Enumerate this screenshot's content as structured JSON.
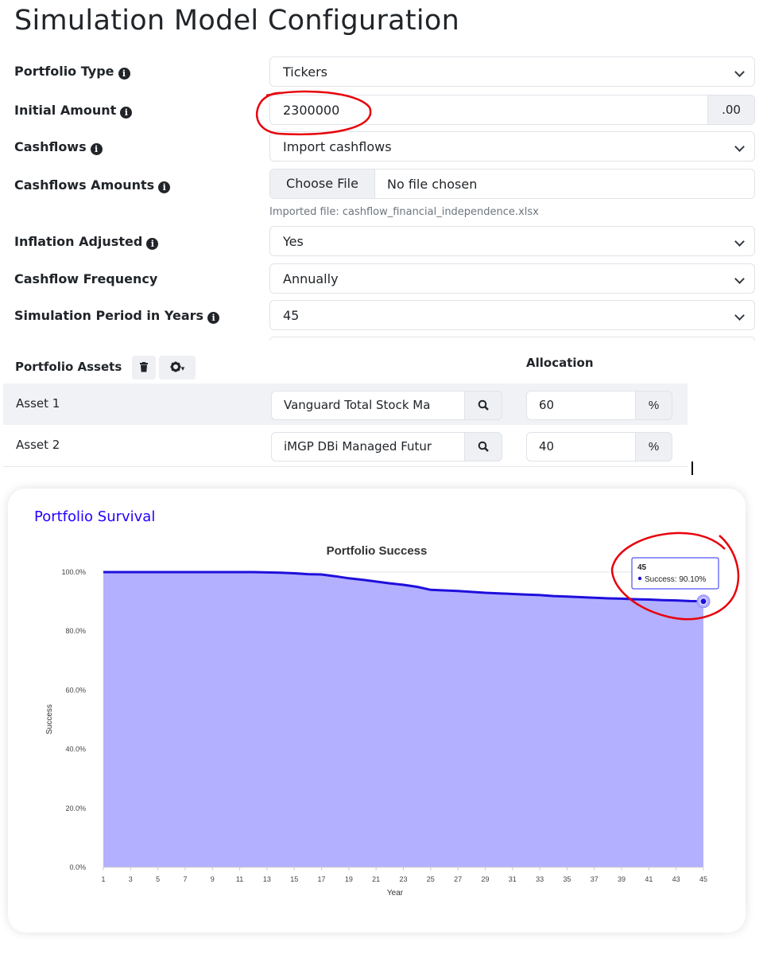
{
  "page_title": "Simulation Model Configuration",
  "form": {
    "portfolio_type": {
      "label": "Portfolio Type",
      "value": "Tickers"
    },
    "initial_amount": {
      "label": "Initial Amount",
      "value": "2300000",
      "addon": ".00"
    },
    "cashflows": {
      "label": "Cashflows",
      "value": "Import cashflows"
    },
    "cashflows_amounts": {
      "label": "Cashflows Amounts",
      "button": "Choose File",
      "file_status": "No file chosen",
      "hint": "Imported file: cashflow_financial_independence.xlsx"
    },
    "inflation_adjusted": {
      "label": "Inflation Adjusted",
      "value": "Yes"
    },
    "cashflow_frequency": {
      "label": "Cashflow Frequency",
      "value": "Annually"
    },
    "simulation_period": {
      "label": "Simulation Period in Years",
      "value": "45"
    }
  },
  "assets": {
    "heading": "Portfolio Assets",
    "allocation_heading": "Allocation",
    "rows": [
      {
        "name": "Asset 1",
        "ticker": "Vanguard Total Stock Ma",
        "allocation": "60",
        "unit": "%"
      },
      {
        "name": "Asset 2",
        "ticker": "iMGP DBi Managed Futur",
        "allocation": "40",
        "unit": "%"
      }
    ]
  },
  "card": {
    "title": "Portfolio Survival"
  },
  "icons": {
    "info": "info-circle-icon",
    "dropdown": "chevron-down-icon",
    "delete": "trash-icon",
    "settings": "gear-icon",
    "search": "search-icon"
  },
  "colors": {
    "line": "#1f0fdc",
    "area": "#b3b0ff",
    "card_title": "#2200ff",
    "annotation": "#e8000b"
  },
  "chart_data": {
    "type": "area",
    "title": "Portfolio Success",
    "xlabel": "Year",
    "ylabel": "Success",
    "ylim": [
      0,
      100
    ],
    "yticks": [
      "0.0%",
      "20.0%",
      "40.0%",
      "60.0%",
      "80.0%",
      "100.0%"
    ],
    "x": [
      1,
      2,
      3,
      4,
      5,
      6,
      7,
      8,
      9,
      10,
      11,
      12,
      13,
      14,
      15,
      16,
      17,
      18,
      19,
      20,
      21,
      22,
      23,
      24,
      25,
      26,
      27,
      28,
      29,
      30,
      31,
      32,
      33,
      34,
      35,
      36,
      37,
      38,
      39,
      40,
      41,
      42,
      43,
      44,
      45
    ],
    "xtick_labels": [
      "1",
      "3",
      "5",
      "7",
      "9",
      "11",
      "13",
      "15",
      "17",
      "19",
      "21",
      "23",
      "25",
      "27",
      "29",
      "31",
      "33",
      "35",
      "37",
      "39",
      "41",
      "43",
      "45"
    ],
    "series": [
      {
        "name": "Success",
        "values": [
          100,
          100,
          100,
          100,
          100,
          100,
          100,
          100,
          100,
          100,
          100,
          100,
          99.9,
          99.8,
          99.6,
          99.3,
          99.2,
          98.6,
          97.9,
          97.4,
          96.8,
          96.2,
          95.7,
          95.0,
          94.0,
          93.8,
          93.6,
          93.3,
          93.0,
          92.8,
          92.6,
          92.4,
          92.2,
          91.9,
          91.7,
          91.5,
          91.3,
          91.1,
          91.0,
          90.8,
          90.7,
          90.5,
          90.4,
          90.2,
          90.1
        ]
      }
    ],
    "tooltip": {
      "x": "45",
      "text": "Success: 90.10%"
    },
    "grid": true,
    "legend": "none"
  }
}
